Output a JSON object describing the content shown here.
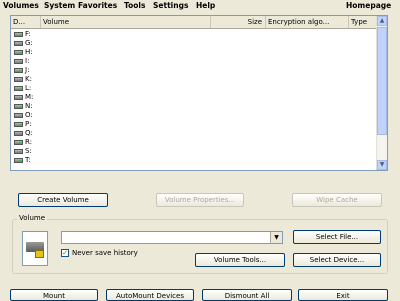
{
  "menu": {
    "items": [
      {
        "label": "Volumes",
        "accel": "V"
      },
      {
        "label": "System",
        "accel": "S"
      },
      {
        "label": "Favorites",
        "accel": "i"
      },
      {
        "label": "Tools",
        "accel": "o"
      },
      {
        "label": "Settings",
        "accel": "g"
      },
      {
        "label": "Help",
        "accel": "H"
      }
    ],
    "homepage": "Homepage"
  },
  "list": {
    "columns": [
      "D...",
      "Volume",
      "Size",
      "Encryption algo...",
      "Type"
    ],
    "drives": [
      "F:",
      "G:",
      "H:",
      "I:",
      "J:",
      "K:",
      "L:",
      "M:",
      "N:",
      "O:",
      "P:",
      "Q:",
      "R:",
      "S:",
      "T:"
    ]
  },
  "buttons": {
    "create_volume": "Create Volume",
    "volume_properties": "Volume Properties...",
    "wipe_cache": "Wipe Cache",
    "select_file": "Select File...",
    "volume_tools": "Volume Tools...",
    "select_device": "Select Device...",
    "mount": "Mount",
    "automount": "AutoMount Devices",
    "dismount_all": "Dismount All",
    "exit": "Exit"
  },
  "volume_group": {
    "label": "Volume",
    "path_value": "",
    "never_save_history": "Never save history",
    "never_save_history_checked": true
  }
}
